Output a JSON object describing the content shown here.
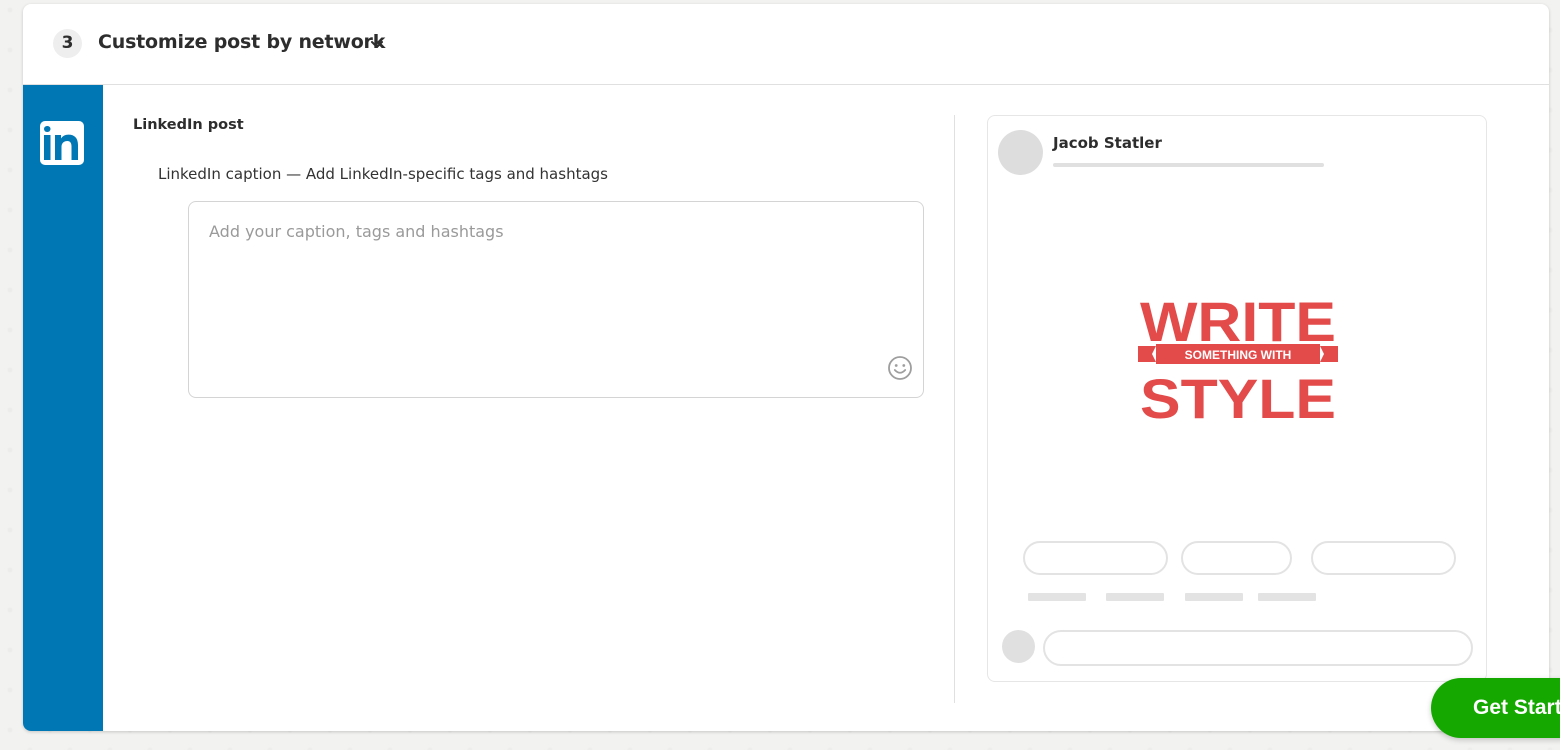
{
  "header": {
    "step_number": "3",
    "title": "Customize post by network",
    "chevron_icon": "chevron-down-icon"
  },
  "network": {
    "name": "LinkedIn",
    "icon": "linkedin-icon",
    "brand_color": "#0077b5",
    "logo_text": "in"
  },
  "editor": {
    "post_title": "LinkedIn post",
    "caption_label": "LinkedIn caption — Add LinkedIn-specific tags and hashtags",
    "caption_value": "",
    "caption_placeholder": "Add your caption, tags and hashtags",
    "emoji_icon": "smiley-icon"
  },
  "preview": {
    "author_name": "Jacob Statler",
    "image": {
      "line1": "WRITE",
      "ribbon": "SOMETHING WITH",
      "line2": "STYLE",
      "color": "#e34b4b"
    }
  },
  "cta": {
    "label": "Get Started",
    "color": "#14a800"
  }
}
